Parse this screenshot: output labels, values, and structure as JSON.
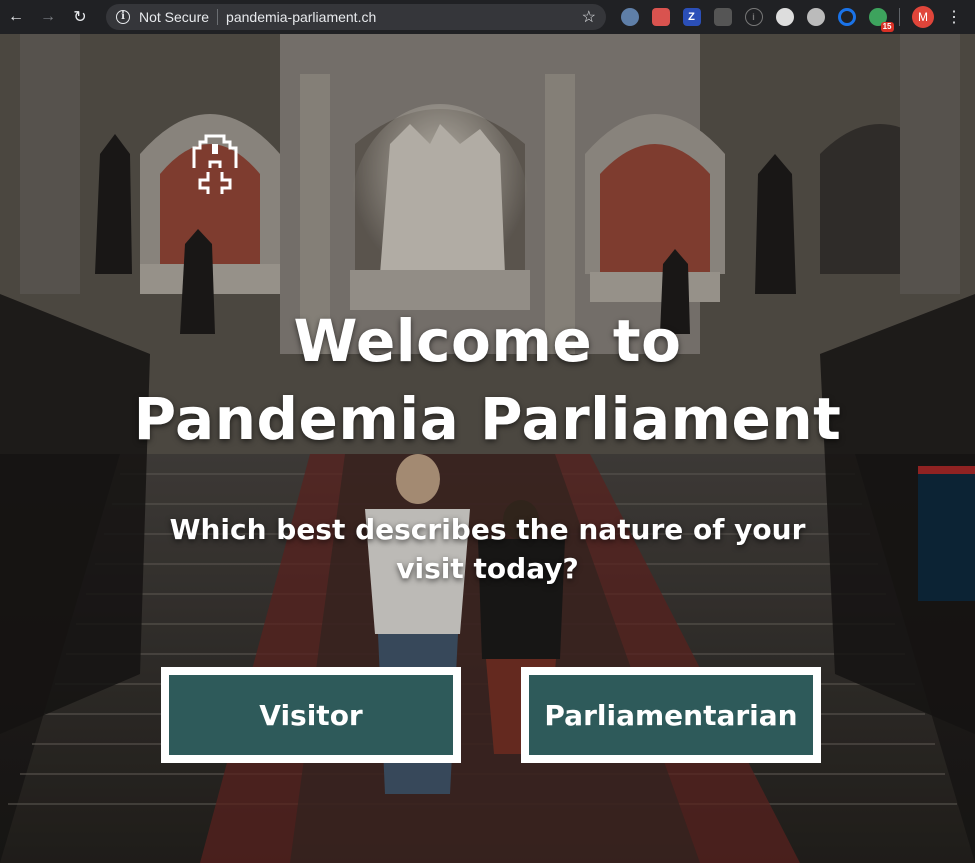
{
  "browser": {
    "security_label": "Not Secure",
    "url": "pandemia-parliament.ch",
    "profile_initial": "M",
    "extension_badge": "15",
    "extensions": [
      "opera-icon",
      "puzzle-icon",
      "z-icon",
      "lightbulb-icon",
      "info-icon",
      "camera-icon",
      "record-icon",
      "edge-icon",
      "green-app-icon"
    ]
  },
  "hero": {
    "title_line1": "Welcome to",
    "title_line2": "Pandemia Parliament",
    "question_line1": "Which best describes the nature of your",
    "question_line2": "visit today?",
    "buttons": {
      "visitor": "Visitor",
      "parliamentarian": "Parliamentarian"
    },
    "colors": {
      "button_bg": "#2e5a5a",
      "button_border": "#ffffff",
      "text": "#ffffff"
    }
  }
}
